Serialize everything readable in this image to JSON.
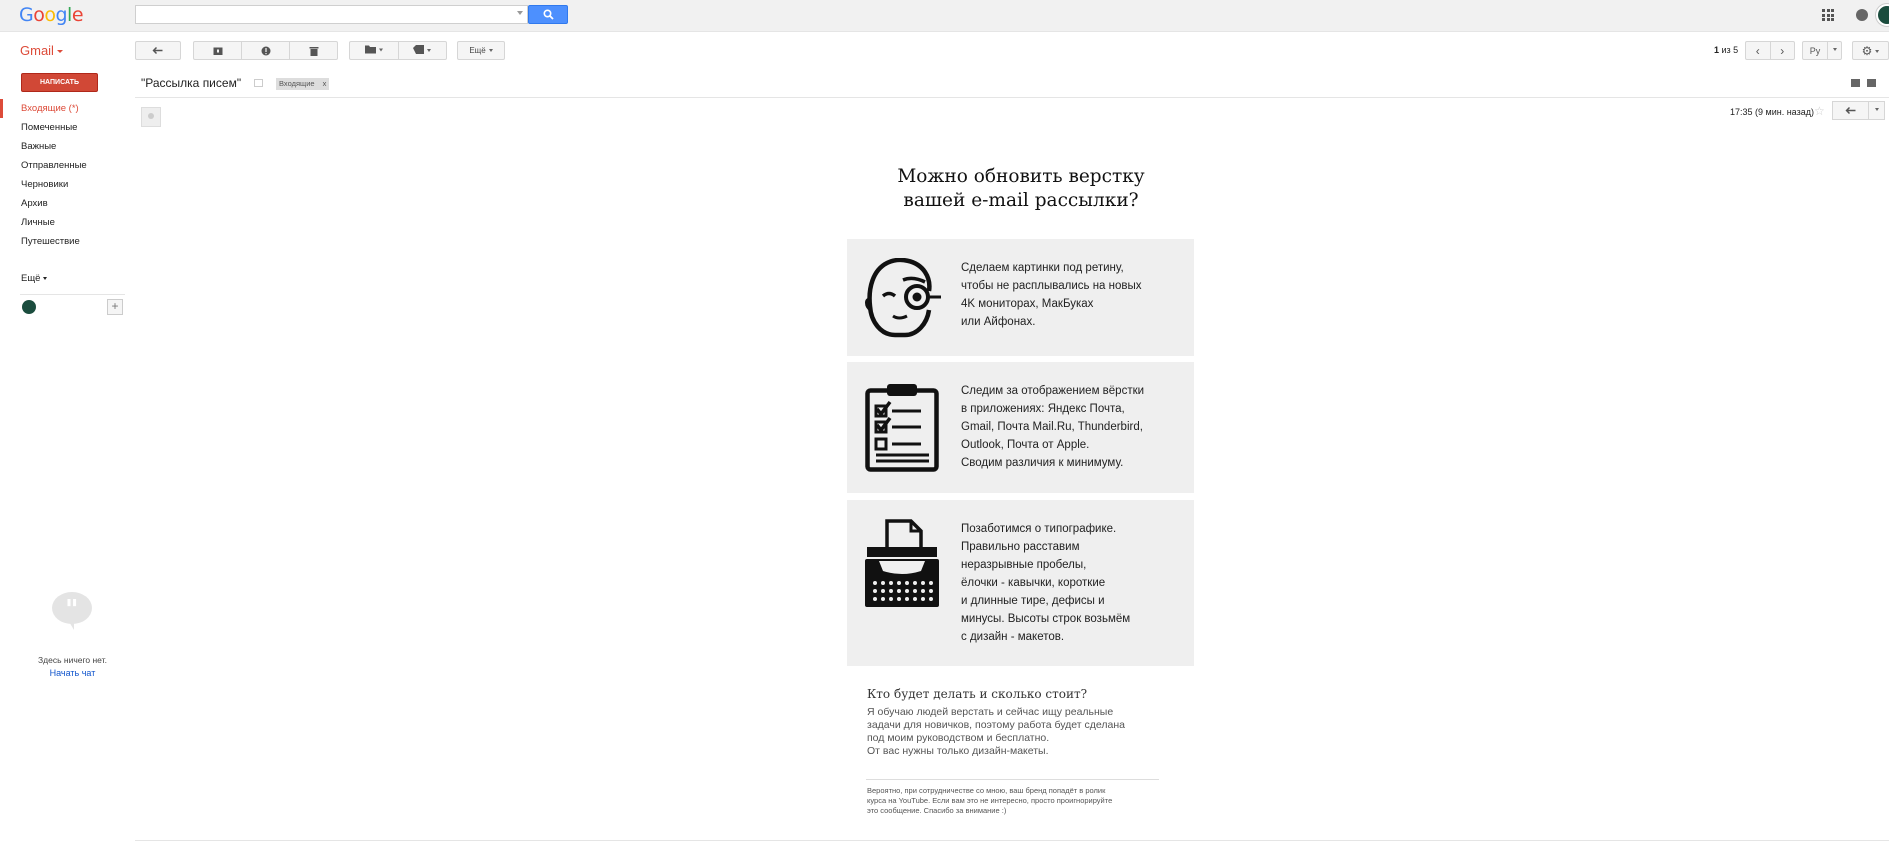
{
  "header": {
    "logo": "Google",
    "logo_colors": [
      "#4285f4",
      "#ea4335",
      "#fbbc05",
      "#4285f4",
      "#34a853",
      "#ea4335"
    ],
    "search_placeholder": ""
  },
  "toolbar": {
    "app_label": "Gmail",
    "more_label": "Ещё",
    "pager_bold": "1",
    "pager_rest": " из 5",
    "lang_label": "Ру"
  },
  "sidebar": {
    "compose_label": "НАПИСАТЬ",
    "items": [
      {
        "label": "Входящие (*)"
      },
      {
        "label": "Помеченные"
      },
      {
        "label": "Важные"
      },
      {
        "label": "Отправленные"
      },
      {
        "label": "Черновики"
      },
      {
        "label": "Архив"
      },
      {
        "label": "Личные"
      },
      {
        "label": "Путешествие"
      }
    ],
    "more_label": "Ещё",
    "chat_empty": "Здесь ничего нет.",
    "chat_start": "Начать чат"
  },
  "message": {
    "subject": "\"Рассылка писем\"",
    "label_chip": "Входящие",
    "label_close": "x",
    "time": "17:35 (9 мин. назад)"
  },
  "email": {
    "headline_1": "Можно обновить верстку",
    "headline_2": "вашей e-mail рассылки?",
    "cards": [
      {
        "icon": "monocle-face-icon",
        "lines": [
          "Сделаем картинки под ретину,",
          "чтобы не расплывались на новых",
          "4K мониторах, МакБуках",
          "или Айфонах."
        ]
      },
      {
        "icon": "checklist-clipboard-icon",
        "lines": [
          "Следим за отображением вёрстки",
          "в приложениях: Яндекс Почта,",
          "Gmail, Почта Mail.Ru, Thunderbird,",
          "Outlook, Почта от Apple.",
          "Сводим различия к минимуму."
        ]
      },
      {
        "icon": "typewriter-icon",
        "lines": [
          "Позаботимся о типографике.",
          "Правильно расставим",
          "неразрывные пробелы,",
          "ёлочки - кавычки, короткие",
          "и длинные тире, дефисы и",
          "минусы. Высоты строк возьмём",
          "с дизайн - макетов."
        ]
      }
    ],
    "who_title": "Кто будет делать и сколько стоит?",
    "who_lines": [
      "Я обучаю людей верстать и сейчас ищу реальные",
      "задачи для новичков, поэтому работа будет сделана",
      "под моим руководством и бесплатно.",
      "От вас нужны только дизайн-макеты."
    ],
    "footer_lines": [
      "Вероятно, при сотрудничестве со мною, ваш бренд попадёт в ролик",
      "курса на YouTube. Если вам это не интересно, просто проигнорируйте",
      "это сообщение. Спасибо за внимание :)"
    ]
  }
}
